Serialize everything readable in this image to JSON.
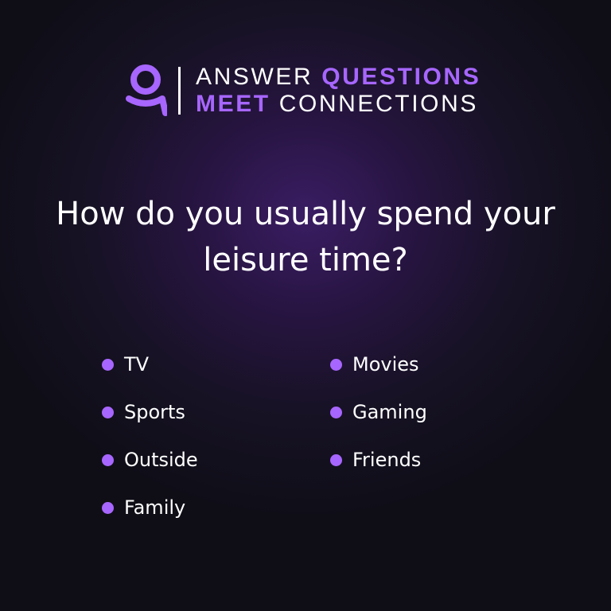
{
  "brand": {
    "line1": {
      "plain": "ANSWER",
      "accent": "QUESTIONS"
    },
    "line2": {
      "accent": "MEET",
      "plain": "CONNECTIONS"
    },
    "logo_icon": "person-icon",
    "accent_color": "#a766ff"
  },
  "question": {
    "line1": "How do you usually spend your",
    "line2": "leisure time?"
  },
  "options": {
    "left": [
      {
        "label": "TV"
      },
      {
        "label": "Sports"
      },
      {
        "label": "Outside"
      },
      {
        "label": "Family"
      }
    ],
    "right": [
      {
        "label": "Movies"
      },
      {
        "label": "Gaming"
      },
      {
        "label": "Friends"
      }
    ]
  }
}
